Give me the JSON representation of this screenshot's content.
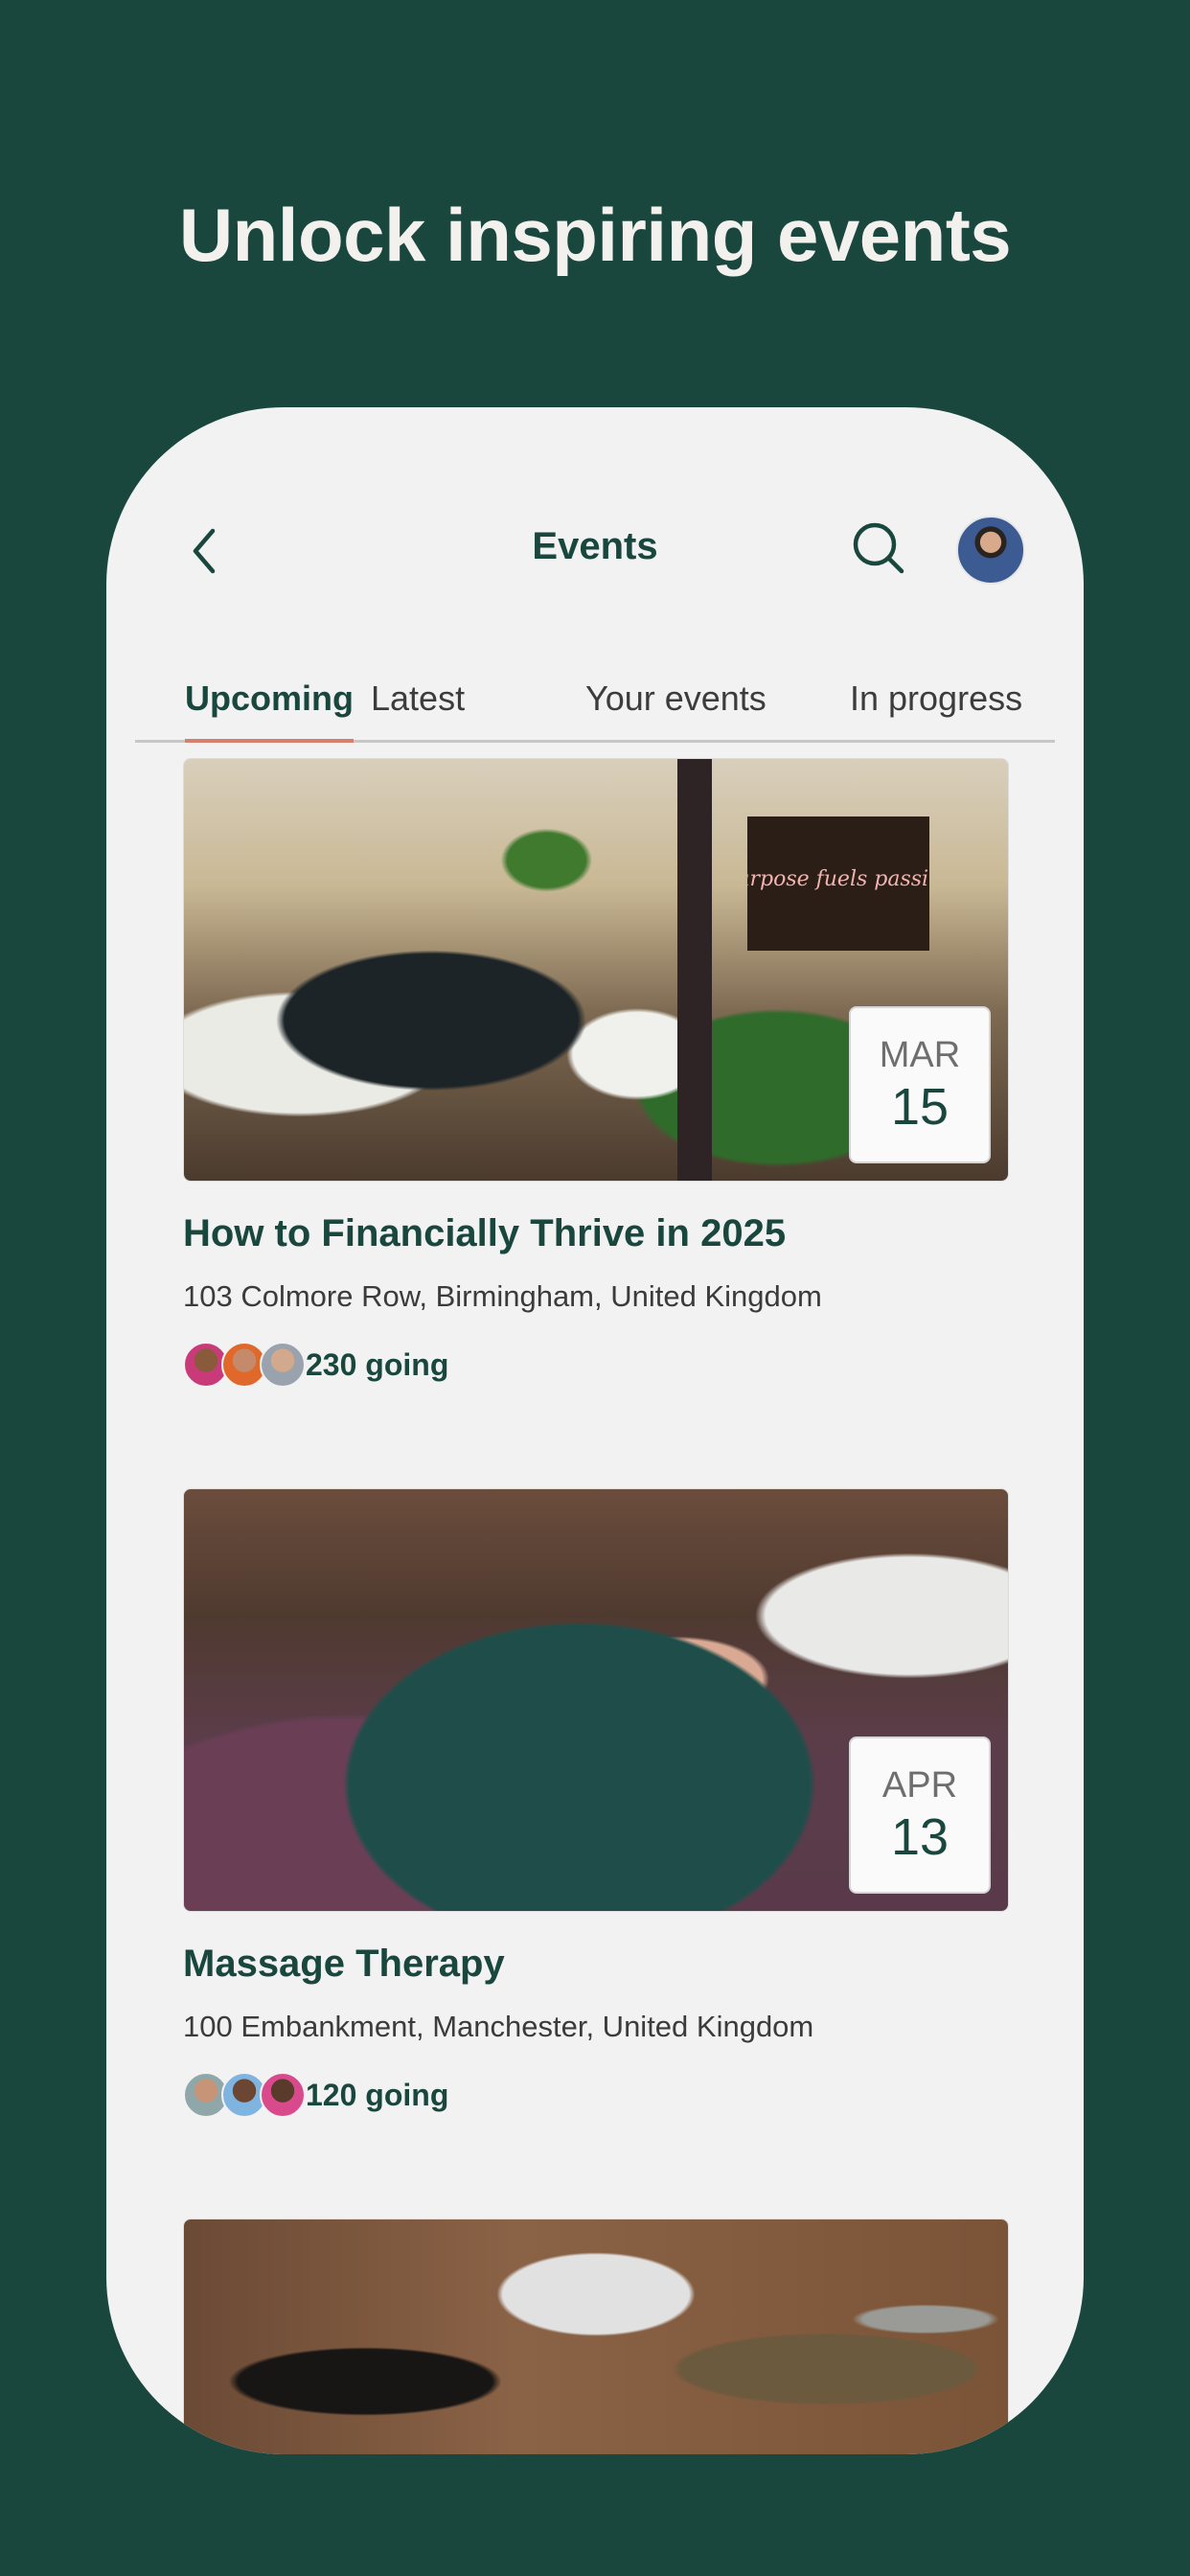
{
  "headline": "Unlock inspiring events",
  "nav": {
    "title": "Events",
    "back_icon": "chevron-left-icon",
    "search_icon": "search-icon"
  },
  "tabs": [
    {
      "label": "Upcoming",
      "active": true
    },
    {
      "label": "Latest",
      "active": false
    },
    {
      "label": "Your events",
      "active": false
    },
    {
      "label": "In progress",
      "active": false
    }
  ],
  "events": [
    {
      "title": "How to Financially Thrive in 2025",
      "address": "103 Colmore Row, Birmingham, United Kingdom",
      "month": "MAR",
      "day": "15",
      "going": "230 going",
      "image_text": "Purpose fuels passion"
    },
    {
      "title": "Massage Therapy",
      "address": "100 Embankment, Manchester, United Kingdom",
      "month": "APR",
      "day": "13",
      "going": "120 going"
    }
  ],
  "colors": {
    "background": "#1a473d",
    "accent": "#d9806c",
    "title": "#1a473d",
    "surface": "#f2f2f2"
  }
}
